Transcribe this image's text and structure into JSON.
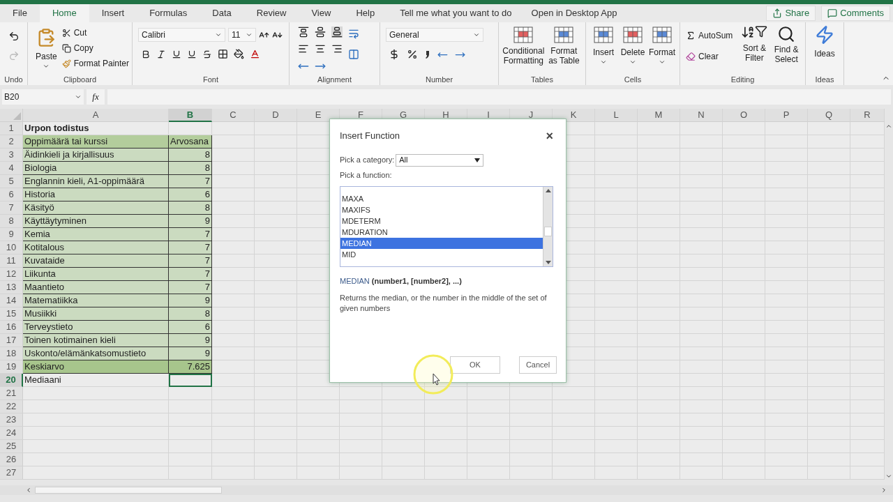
{
  "tabs": [
    {
      "label": "File",
      "selected": false
    },
    {
      "label": "Home",
      "selected": true
    },
    {
      "label": "Insert",
      "selected": false
    },
    {
      "label": "Formulas",
      "selected": false
    },
    {
      "label": "Data",
      "selected": false
    },
    {
      "label": "Review",
      "selected": false
    },
    {
      "label": "View",
      "selected": false
    },
    {
      "label": "Help",
      "selected": false
    }
  ],
  "tell_me": "Tell me what you want to do",
  "open_desktop": "Open in Desktop App",
  "share": "Share",
  "comments": "Comments",
  "ribbon": {
    "undo": {
      "label": "Undo"
    },
    "clipboard": {
      "paste": "Paste",
      "cut": "Cut",
      "copy": "Copy",
      "format_painter": "Format Painter",
      "label": "Clipboard"
    },
    "font": {
      "name": "Calibri",
      "size": "11",
      "label": "Font"
    },
    "alignment": {
      "label": "Alignment"
    },
    "number": {
      "format": "General",
      "label": "Number"
    },
    "tables": {
      "conditional": "Conditional Formatting",
      "format_table": "Format as Table",
      "label": "Tables"
    },
    "cells": {
      "buttons": [
        "Insert",
        "Delete",
        "Format"
      ],
      "label": "Cells"
    },
    "editing": {
      "autosum": "AutoSum",
      "clear": "Clear",
      "sort": "Sort & Filter",
      "find": "Find & Select",
      "label": "Editing"
    },
    "ideas": {
      "button": "Ideas",
      "label": "Ideas"
    }
  },
  "formula_bar": {
    "name_box": "B20",
    "function_button": "fx"
  },
  "columns": [
    {
      "label": "A",
      "selected": false
    },
    {
      "label": "B",
      "selected": true
    },
    {
      "label": "C",
      "selected": false
    },
    {
      "label": "D",
      "selected": false
    },
    {
      "label": "E",
      "selected": false
    },
    {
      "label": "F",
      "selected": false
    },
    {
      "label": "G",
      "selected": false
    },
    {
      "label": "H",
      "selected": false
    },
    {
      "label": "I",
      "selected": false
    },
    {
      "label": "J",
      "selected": false
    },
    {
      "label": "K",
      "selected": false
    },
    {
      "label": "L",
      "selected": false
    },
    {
      "label": "M",
      "selected": false
    },
    {
      "label": "N",
      "selected": false
    },
    {
      "label": "O",
      "selected": false
    },
    {
      "label": "P",
      "selected": false
    },
    {
      "label": "Q",
      "selected": false
    },
    {
      "label": "R",
      "selected": false
    }
  ],
  "rows": [
    {
      "number": "1",
      "selected": false,
      "kind": "title",
      "a": "Urpon todistus"
    },
    {
      "number": "2",
      "selected": false,
      "kind": "header",
      "a": "Oppimäärä tai kurssi",
      "b": "Arvosana"
    },
    {
      "number": "3",
      "selected": false,
      "kind": "body",
      "a": "Äidinkieli ja kirjallisuus",
      "b": "8"
    },
    {
      "number": "4",
      "selected": false,
      "kind": "body",
      "a": "Biologia",
      "b": "8"
    },
    {
      "number": "5",
      "selected": false,
      "kind": "body",
      "a": "Englannin kieli, A1-oppimäärä",
      "b": "7"
    },
    {
      "number": "6",
      "selected": false,
      "kind": "body",
      "a": "Historia",
      "b": "6"
    },
    {
      "number": "7",
      "selected": false,
      "kind": "body",
      "a": "Käsityö",
      "b": "8"
    },
    {
      "number": "8",
      "selected": false,
      "kind": "body",
      "a": "Käyttäytyminen",
      "b": "9"
    },
    {
      "number": "9",
      "selected": false,
      "kind": "body",
      "a": "Kemia",
      "b": "7"
    },
    {
      "number": "10",
      "selected": false,
      "kind": "body",
      "a": "Kotitalous",
      "b": "7"
    },
    {
      "number": "11",
      "selected": false,
      "kind": "body",
      "a": "Kuvataide",
      "b": "7"
    },
    {
      "number": "12",
      "selected": false,
      "kind": "body",
      "a": "Liikunta",
      "b": "7"
    },
    {
      "number": "13",
      "selected": false,
      "kind": "body",
      "a": "Maantieto",
      "b": "7"
    },
    {
      "number": "14",
      "selected": false,
      "kind": "body",
      "a": "Matematiikka",
      "b": "9"
    },
    {
      "number": "15",
      "selected": false,
      "kind": "body",
      "a": "Musiikki",
      "b": "8"
    },
    {
      "number": "16",
      "selected": false,
      "kind": "body",
      "a": "Terveystieto",
      "b": "6"
    },
    {
      "number": "17",
      "selected": false,
      "kind": "body",
      "a": "Toinen kotimainen kieli",
      "b": "9"
    },
    {
      "number": "18",
      "selected": false,
      "kind": "body",
      "a": "Uskonto/elämänkatsomustieto",
      "b": "9"
    },
    {
      "number": "19",
      "selected": false,
      "kind": "total",
      "a": "Keskiarvo",
      "b": "7.625"
    },
    {
      "number": "20",
      "selected": true,
      "kind": "plain",
      "a": "Mediaani"
    },
    {
      "number": "21",
      "selected": false,
      "kind": "plain"
    },
    {
      "number": "22",
      "selected": false,
      "kind": "plain"
    },
    {
      "number": "23",
      "selected": false,
      "kind": "plain"
    },
    {
      "number": "24",
      "selected": false,
      "kind": "plain"
    },
    {
      "number": "25",
      "selected": false,
      "kind": "plain"
    },
    {
      "number": "26",
      "selected": false,
      "kind": "plain"
    },
    {
      "number": "27",
      "selected": false,
      "kind": "plain"
    }
  ],
  "dialog": {
    "title": "Insert Function",
    "close": "×",
    "category_label": "Pick a category:",
    "category": "All",
    "function_label": "Pick a function:",
    "functions": [
      {
        "name": "MAXA",
        "selected": false
      },
      {
        "name": "MAXIFS",
        "selected": false
      },
      {
        "name": "MDETERM",
        "selected": false
      },
      {
        "name": "MDURATION",
        "selected": false
      },
      {
        "name": "MEDIAN",
        "selected": true
      },
      {
        "name": "MID",
        "selected": false
      }
    ],
    "signature_name": "MEDIAN",
    "signature_args": "(number1, [number2], ...)",
    "description": "Returns the median, or the number in the middle of the set of given numbers",
    "ok": "OK",
    "cancel": "Cancel"
  }
}
